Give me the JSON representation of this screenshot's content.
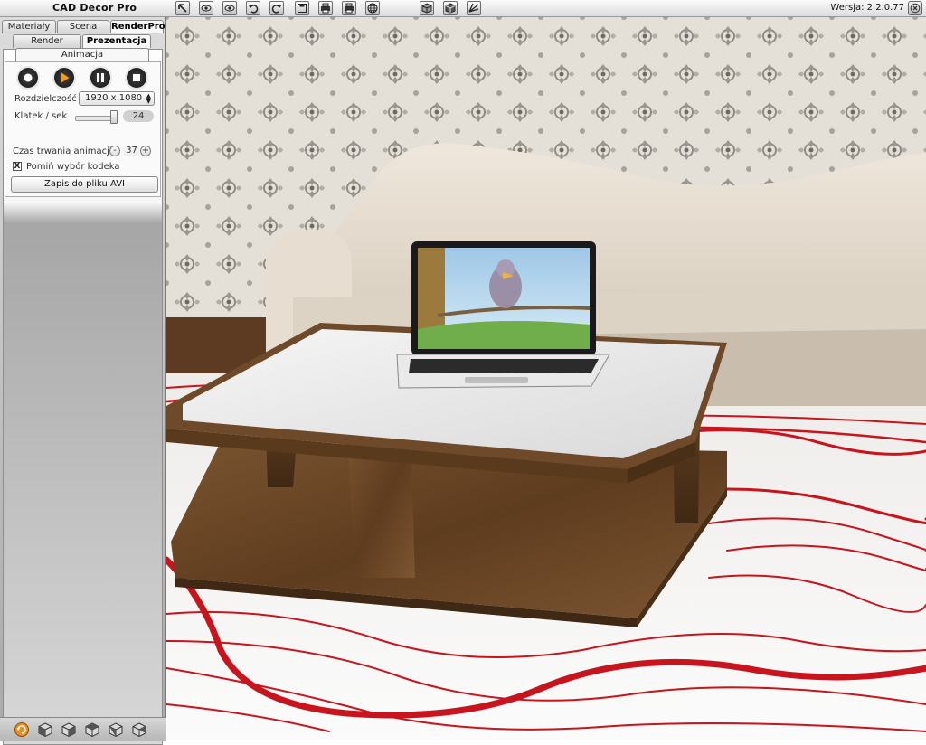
{
  "app": {
    "title": "CAD Decor Pro",
    "version": "Wersja: 2.2.0.77"
  },
  "toolbar": {
    "tools": [
      "select-arrow-icon",
      "eye-icon",
      "eye-icon",
      "undo-icon",
      "redo-icon",
      "save-icon",
      "print-icon",
      "print-icon",
      "globe-icon",
      "cube-icon",
      "cube-icon",
      "camera-view-icon"
    ]
  },
  "panel": {
    "main_tabs": [
      {
        "label": "Materiały",
        "active": false
      },
      {
        "label": "Scena",
        "active": false
      },
      {
        "label": "RenderPro",
        "active": true
      }
    ],
    "sub_tabs": [
      {
        "label": "Render",
        "active": false
      },
      {
        "label": "Prezentacja",
        "active": true
      }
    ],
    "section_tab": "Animacja",
    "controls": [
      "record-icon",
      "play-icon",
      "pause-icon",
      "stop-icon"
    ],
    "resolution": {
      "label": "Rozdzielczość",
      "value": "1920 x 1080"
    },
    "fps": {
      "label": "Klatek / sek",
      "value": "24",
      "level": 0.95
    },
    "duration": {
      "label": "Czas trwania animacji:",
      "minus": "-",
      "value": "37",
      "plus": "+"
    },
    "skip_codec": {
      "label": "Pomiń wybór kodeka",
      "checked": true,
      "mark": "X"
    },
    "save_button": "Zapis do pliku AVI"
  },
  "bottom_bar": {
    "icons": [
      "refresh-icon",
      "cube-view-front-icon",
      "cube-view-left-icon",
      "cube-view-top-icon",
      "cube-view-right-icon",
      "cube-view-back-icon"
    ]
  },
  "colors": {
    "accent_orange": "#e8901e",
    "carpet_red": "#c8141c",
    "wood": "#6e4a2a"
  }
}
